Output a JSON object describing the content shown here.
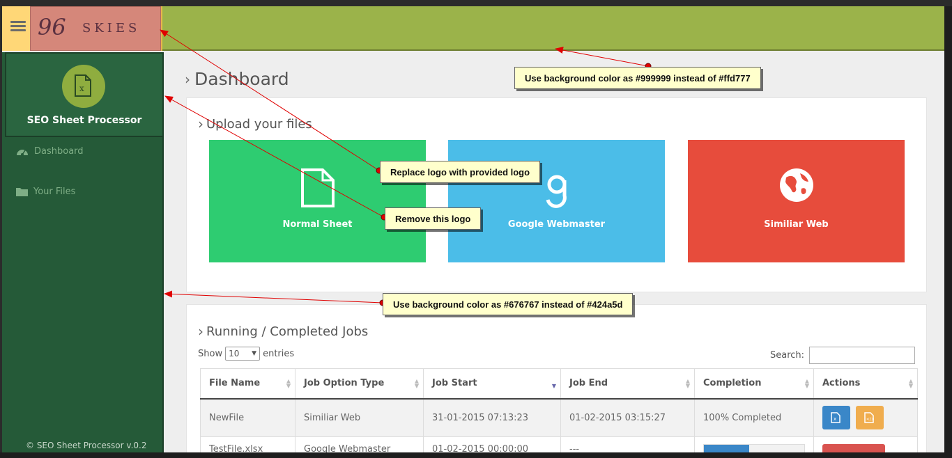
{
  "brand": {
    "logo_number": "96",
    "logo_word": "SKIES",
    "app_name": "SEO Sheet Processor"
  },
  "sidebar": {
    "items": [
      {
        "label": "Dashboard",
        "icon": "dashboard-icon"
      },
      {
        "label": "Your Files",
        "icon": "folder-icon"
      }
    ],
    "footer": "© SEO Sheet Processor v.0.2"
  },
  "page": {
    "title": "Dashboard"
  },
  "upload": {
    "title": "Upload your files",
    "tiles": [
      {
        "label": "Normal Sheet",
        "color": "#2ecc71",
        "icon": "file-icon"
      },
      {
        "label": "Google Webmaster",
        "color": "#4bbde8",
        "icon": "google-icon"
      },
      {
        "label": "Similiar Web",
        "color": "#e74c3c",
        "icon": "globe-icon"
      }
    ]
  },
  "jobs": {
    "title": "Running / Completed Jobs",
    "show_label": "Show",
    "entries_value": "10",
    "entries_label": "entries",
    "search_label": "Search:",
    "columns": [
      "File Name",
      "Job Option Type",
      "Job Start",
      "Job End",
      "Completion",
      "Actions"
    ],
    "rows": [
      {
        "file": "NewFile",
        "type": "Similiar Web",
        "start": "31-01-2015 07:13:23",
        "end": "01-02-2015 03:15:27",
        "completion": "100% Completed"
      },
      {
        "file": "TestFile.xlsx",
        "type": "Google Webmaster",
        "start": "01-02-2015 00:00:00",
        "end": "---",
        "progress": 0.45
      }
    ]
  },
  "annotations": [
    "Use background color as #999999 instead of #ffd777",
    "Replace logo with provided logo",
    "Remove this logo",
    "Use background color as #676767 instead of #424a5d"
  ],
  "colors": {
    "header": "#9bb34a",
    "brandbar": "#ffd777",
    "sidebar": "#255a38",
    "accent": "#8fad3f"
  }
}
